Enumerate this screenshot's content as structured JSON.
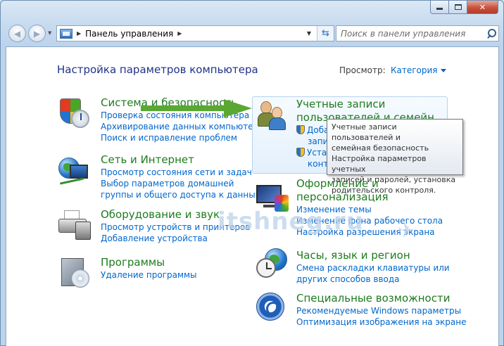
{
  "window": {
    "caption": {
      "close_glyph": "✕"
    }
  },
  "nav": {
    "address": "Панель управления",
    "search_placeholder": "Поиск в панели управления"
  },
  "page": {
    "title": "Настройка параметров компьютера",
    "view_by_label": "Просмотр:",
    "view_by_value": "Категория"
  },
  "categories": [
    {
      "title": "Система и безопасность",
      "links": [
        "Проверка состояния компьютера",
        "Архивирование данных компьютера",
        "Поиск и исправление проблем"
      ]
    },
    {
      "title": "Сеть и Интернет",
      "links": [
        "Просмотр состояния сети и задач",
        "Выбор параметров домашней",
        "группы и общего доступа к данным"
      ]
    },
    {
      "title": "Оборудование и звук",
      "links": [
        "Просмотр устройств и принтеров",
        "Добавление устройства"
      ]
    },
    {
      "title": "Программы",
      "links": [
        "Удаление программы"
      ]
    },
    {
      "title_line1": "Учетные записи",
      "title_line2": "пользователей и семейн",
      "links": [
        "Доба",
        "запи",
        "Уста",
        "конт"
      ]
    },
    {
      "title_line1": "Оформление и",
      "title_line2": "персонализация",
      "links": [
        "Изменение темы",
        "Изменение фона рабочего стола",
        "Настройка разрешения экрана"
      ]
    },
    {
      "title": "Часы, язык и регион",
      "links": [
        "Смена раскладки клавиатуры или",
        "других способов ввода"
      ]
    },
    {
      "title": "Специальные возможности",
      "links": [
        "Рекомендуемые Windows параметры",
        "Оптимизация изображения на экране"
      ]
    }
  ],
  "tooltip": {
    "lines": [
      "Учетные записи пользователей и",
      "семейная безопасность",
      "Настройка параметров учетных",
      "записей и паролей, установка",
      "родительского контроля."
    ]
  },
  "watermark": {
    "text": "itshneg.ru"
  },
  "colors": {
    "category_title": "#1e7b1e",
    "link": "#0066cc",
    "page_title": "#1e3287",
    "arrow": "#5aa832"
  }
}
